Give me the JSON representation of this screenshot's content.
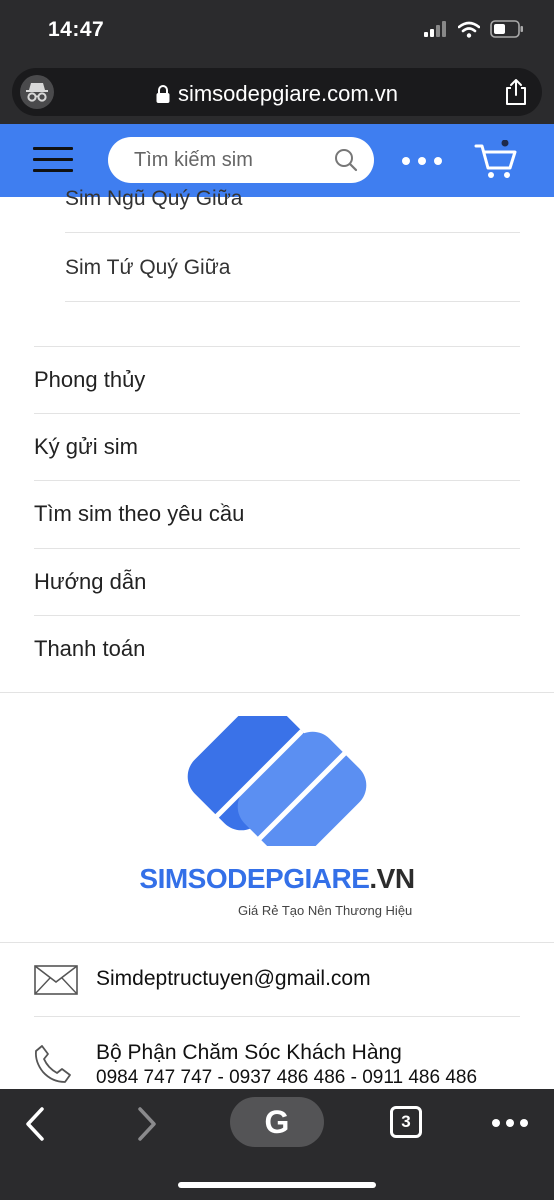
{
  "status_bar": {
    "time": "14:47"
  },
  "browser": {
    "url": "simsodepgiare.com.vn"
  },
  "header": {
    "search_placeholder": "Tìm kiếm sim",
    "accent_color": "#3f7ef0"
  },
  "menu": {
    "sub_items": [
      {
        "label": "Sim Ngũ Quý Giữa"
      },
      {
        "label": "Sim Tứ Quý Giữa"
      }
    ],
    "main_items": [
      {
        "label": "Phong thủy"
      },
      {
        "label": "Ký gửi sim"
      },
      {
        "label": "Tìm sim theo yêu cầu"
      },
      {
        "label": "Hướng dẫn"
      },
      {
        "label": "Thanh toán"
      }
    ]
  },
  "logo": {
    "brand_main": "SIMSODEPGIARE",
    "brand_suffix": ".VN",
    "tagline": "Giá Rẻ Tạo Nên Thương Hiệu"
  },
  "contact": {
    "email": "Simdeptructuyen@gmail.com",
    "phone_title": "Bộ Phận Chăm Sóc Khách Hàng",
    "phone_numbers": "0984 747 747 - 0937 486 486 - 0911 486 486"
  },
  "toolbar": {
    "google_label": "G",
    "tab_count": "3"
  },
  "icons": {
    "incognito": "incognito-icon",
    "lock": "lock-icon",
    "share": "share-icon",
    "menu": "hamburger-icon",
    "search": "search-icon",
    "more": "more-icon",
    "cart": "cart-icon",
    "email": "envelope-icon",
    "phone": "phone-icon"
  }
}
